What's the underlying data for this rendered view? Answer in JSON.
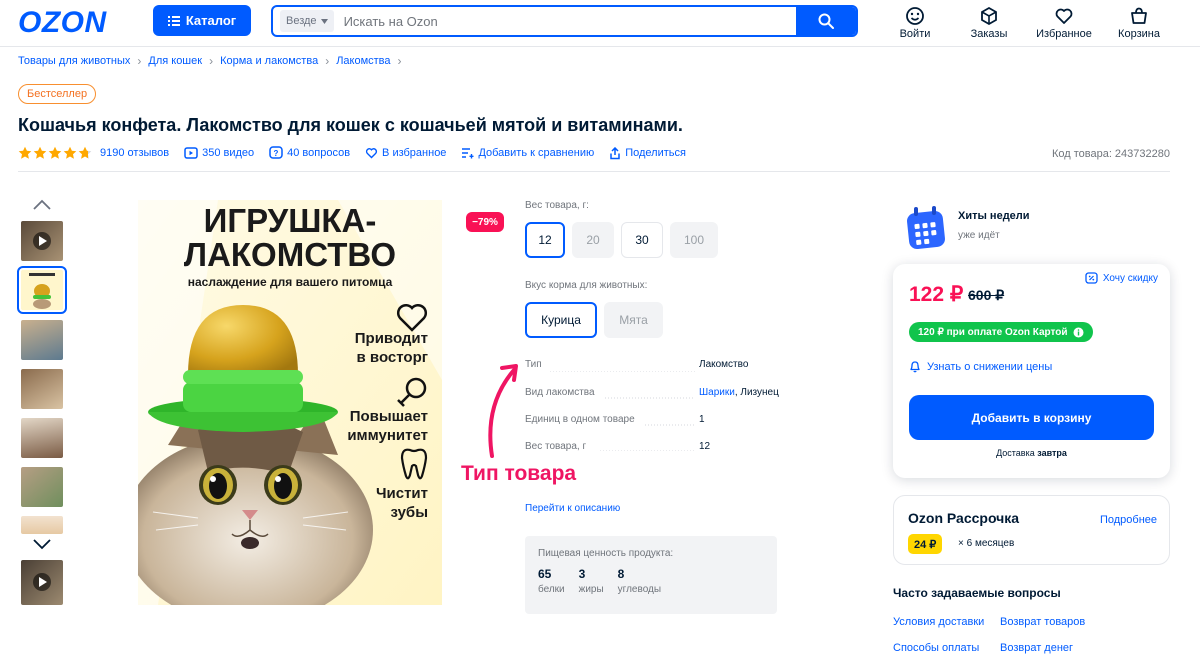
{
  "header": {
    "logo": "OZON",
    "catalog_label": "Каталог",
    "search_scope": "Везде",
    "search_placeholder": "Искать на Ozon",
    "nav": [
      {
        "label": "Войти",
        "icon": "smile-icon"
      },
      {
        "label": "Заказы",
        "icon": "box-icon"
      },
      {
        "label": "Избранное",
        "icon": "heart-icon"
      },
      {
        "label": "Корзина",
        "icon": "bag-icon"
      }
    ]
  },
  "breadcrumbs": [
    "Товары для животных",
    "Для кошек",
    "Корма и лакомства",
    "Лакомства"
  ],
  "product": {
    "badge": "Бестселлер",
    "title": "Кошачья конфета. Лакомство для кошек с кошачьей мятой и витаминами.",
    "rating": 4.8,
    "reviews": "9190 отзывов",
    "videos": "350 видео",
    "questions": "40 вопросов",
    "favorite": "В избранное",
    "compare": "Добавить к сравнению",
    "share": "Поделиться",
    "code": "Код товара: 243732280",
    "discount": "−79%"
  },
  "hero": {
    "headline_1": "ИГРУШКА-",
    "headline_2": "ЛАКОМСТВО",
    "subline": "наслаждение для вашего питомца",
    "benefit_1": [
      "Приводит",
      "в восторг"
    ],
    "benefit_2": [
      "Повышает",
      "иммунитет"
    ],
    "benefit_3": [
      "Чистит",
      "зубы"
    ]
  },
  "options": {
    "weight_label": "Вес товара, г:",
    "weights": [
      {
        "label": "12",
        "state": "selected"
      },
      {
        "label": "20",
        "state": "disabled"
      },
      {
        "label": "30",
        "state": "normal"
      },
      {
        "label": "100",
        "state": "disabled"
      }
    ],
    "flavor_label": "Вкус корма для животных:",
    "flavors": [
      {
        "label": "Курица",
        "state": "selected"
      },
      {
        "label": "Мята",
        "state": "disabled"
      }
    ]
  },
  "characteristics": [
    {
      "key": "Тип",
      "value": "Лакомство"
    },
    {
      "key": "Вид лакомства",
      "value_link": "Шарики",
      "value_rest": ", Лизунец"
    },
    {
      "key": "Единиц в одном товаре",
      "value": "1"
    },
    {
      "key": "Вес товара, г",
      "value": "12"
    }
  ],
  "annotation": "Тип товара",
  "goto_description": "Перейти к описанию",
  "nutrition": {
    "title": "Пищевая ценность продукта:",
    "items": [
      {
        "value": "65",
        "label": "белки"
      },
      {
        "value": "3",
        "label": "жиры"
      },
      {
        "value": "8",
        "label": "углеводы"
      }
    ]
  },
  "hits": {
    "title": "Хиты недели",
    "subtitle": "уже идёт"
  },
  "price_card": {
    "want_discount": "Хочу скидку",
    "price": "122 ₽",
    "old_price": "600 ₽",
    "ozon_card": "120 ₽ при оплате Ozon Картой",
    "notify": "Узнать о снижении цены",
    "add_to_cart": "Добавить в корзину",
    "delivery_prefix": "Доставка",
    "delivery_day": "завтра"
  },
  "installment": {
    "title": "Ozon Рассрочка",
    "more": "Подробнее",
    "amount": "24 ₽",
    "term": "× 6 месяцев"
  },
  "faq": {
    "title": "Часто задаваемые вопросы",
    "links": [
      "Условия доставки",
      "Возврат товаров",
      "Способы оплаты",
      "Возврат денег"
    ]
  },
  "colors": {
    "brand_blue": "#005bff",
    "price_red": "#f91155",
    "card_green": "#10c44c",
    "annotation_pink": "#ef1563",
    "installment_yellow": "#ffd600"
  }
}
